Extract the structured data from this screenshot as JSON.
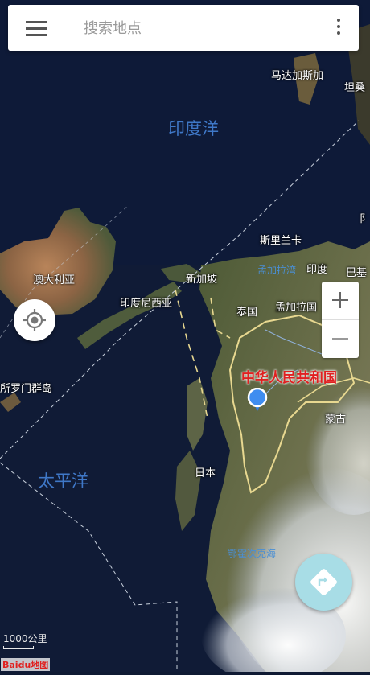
{
  "search": {
    "placeholder": "搜索地点"
  },
  "map": {
    "oceans": {
      "indian": "印度洋",
      "pacific": "太平洋"
    },
    "places": {
      "madagascar": "马达加斯加",
      "tanzania": "坦桑",
      "australia": "澳大利亚",
      "indonesia": "印度尼西亚",
      "singapore": "新加坡",
      "srilanka": "斯里兰卡",
      "india": "印度",
      "thailand": "泰国",
      "bangladesh": "孟加拉国",
      "china": "中华人民共和国",
      "mongolia": "蒙古",
      "japan": "日本",
      "solomon": "所罗门群岛",
      "cut_off": "阝",
      "cut_off_2": "巴基"
    },
    "waters": {
      "bengal": "孟加拉湾",
      "okhotsk": "鄂霍次克海"
    }
  },
  "controls": {
    "zoom_in": "+",
    "zoom_out": "−",
    "menu_icon": "menu-icon",
    "more_icon": "more-vertical-icon",
    "locate_icon": "crosshair-icon",
    "route_icon": "directions-icon"
  },
  "scale": {
    "label": "1000公里"
  },
  "logo": {
    "text": "Baidu地图"
  },
  "colors": {
    "china_label": "#e02020",
    "ocean_label": "#3f78c8",
    "route_button": "#a8dde6"
  }
}
